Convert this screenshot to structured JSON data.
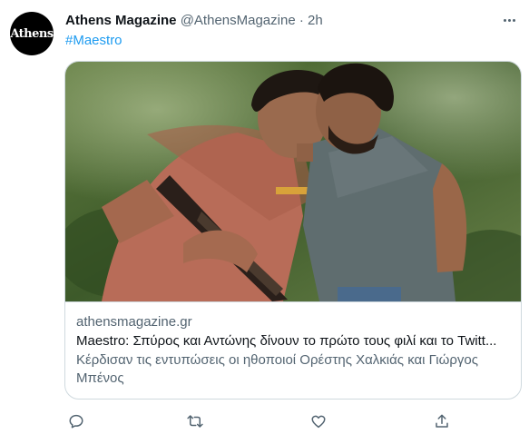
{
  "author": {
    "name": "Athens Magazine",
    "handle": "@AthensMagazine",
    "separator": "·",
    "time": "2h",
    "avatar_text": "Athens"
  },
  "tweet": {
    "hashtag": "#Maestro"
  },
  "card": {
    "domain": "athensmagazine.gr",
    "title": "Maestro: Σπύρος και Αντώνης δίνουν το πρώτο τους φιλί και το Twitt...",
    "description": "Κέρδισαν τις εντυπώσεις οι ηθοποιοί Ορέστης Χαλκιάς και Γιώργος Μπένος"
  },
  "icons": {
    "more": "more-options-icon",
    "reply": "reply-icon",
    "retweet": "retweet-icon",
    "like": "like-icon",
    "share": "share-icon"
  },
  "colors": {
    "link": "#1d9bf0",
    "secondary_text": "#536471",
    "border": "#cfd9de",
    "brand_red": "#d6232a"
  }
}
